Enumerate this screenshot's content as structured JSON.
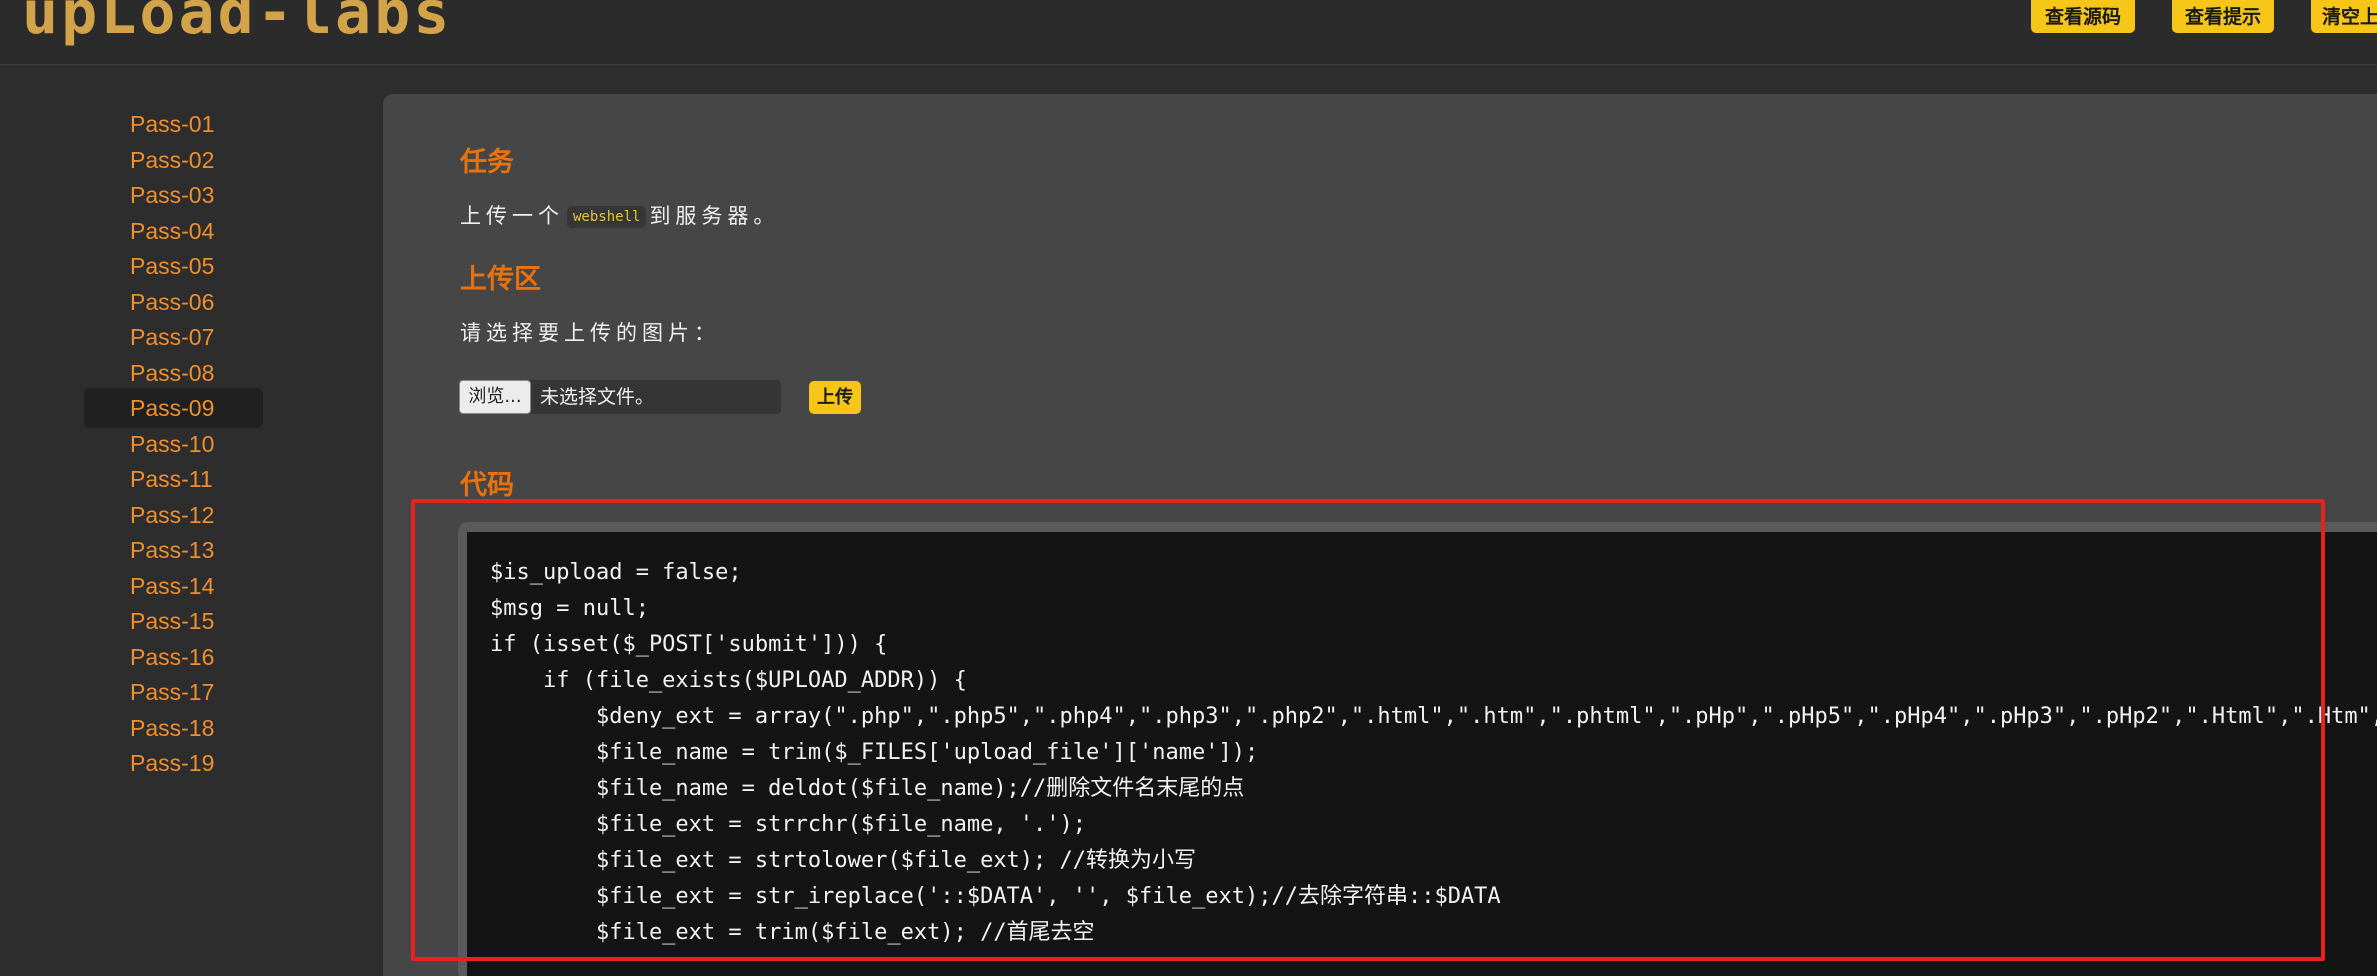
{
  "header": {
    "logo": "upLoad-labs",
    "buttons": [
      "查看源码",
      "查看提示",
      "清空上"
    ]
  },
  "sidebar": {
    "items": [
      "Pass-01",
      "Pass-02",
      "Pass-03",
      "Pass-04",
      "Pass-05",
      "Pass-06",
      "Pass-07",
      "Pass-08",
      "Pass-09",
      "Pass-10",
      "Pass-11",
      "Pass-12",
      "Pass-13",
      "Pass-14",
      "Pass-15",
      "Pass-16",
      "Pass-17",
      "Pass-18",
      "Pass-19"
    ],
    "active_index": 8
  },
  "task": {
    "title": "任务",
    "text_before": "上传一个",
    "chip": "webshell",
    "text_after": "到服务器。"
  },
  "upload": {
    "title": "上传区",
    "prompt": "请选择要上传的图片：",
    "browse_label": "浏览...",
    "file_status": "未选择文件。",
    "submit_label": "上传"
  },
  "code": {
    "title": "代码",
    "lines": [
      "$is_upload = false;",
      "$msg = null;",
      "if (isset($_POST['submit'])) {",
      "    if (file_exists($UPLOAD_ADDR)) {",
      "        $deny_ext = array(\".php\",\".php5\",\".php4\",\".php3\",\".php2\",\".html\",\".htm\",\".phtml\",\".pHp\",\".pHp5\",\".pHp4\",\".pHp3\",\".pHp2\",\".Html\",\".Htm\",\".pHtml\",\".jsp\",\".jspa\",",
      "        $file_name = trim($_FILES['upload_file']['name']);",
      "        $file_name = deldot($file_name);//删除文件名末尾的点",
      "        $file_ext = strrchr($file_name, '.');",
      "        $file_ext = strtolower($file_ext); //转换为小写",
      "        $file_ext = str_ireplace('::$DATA', '', $file_ext);//去除字符串::$DATA",
      "        $file_ext = trim($file_ext); //首尾去空"
    ]
  },
  "colors": {
    "accent": "#e8720e",
    "nav_link": "#ef8f2d",
    "button_yellow": "#f5c518",
    "highlight_red": "#e8231f"
  }
}
